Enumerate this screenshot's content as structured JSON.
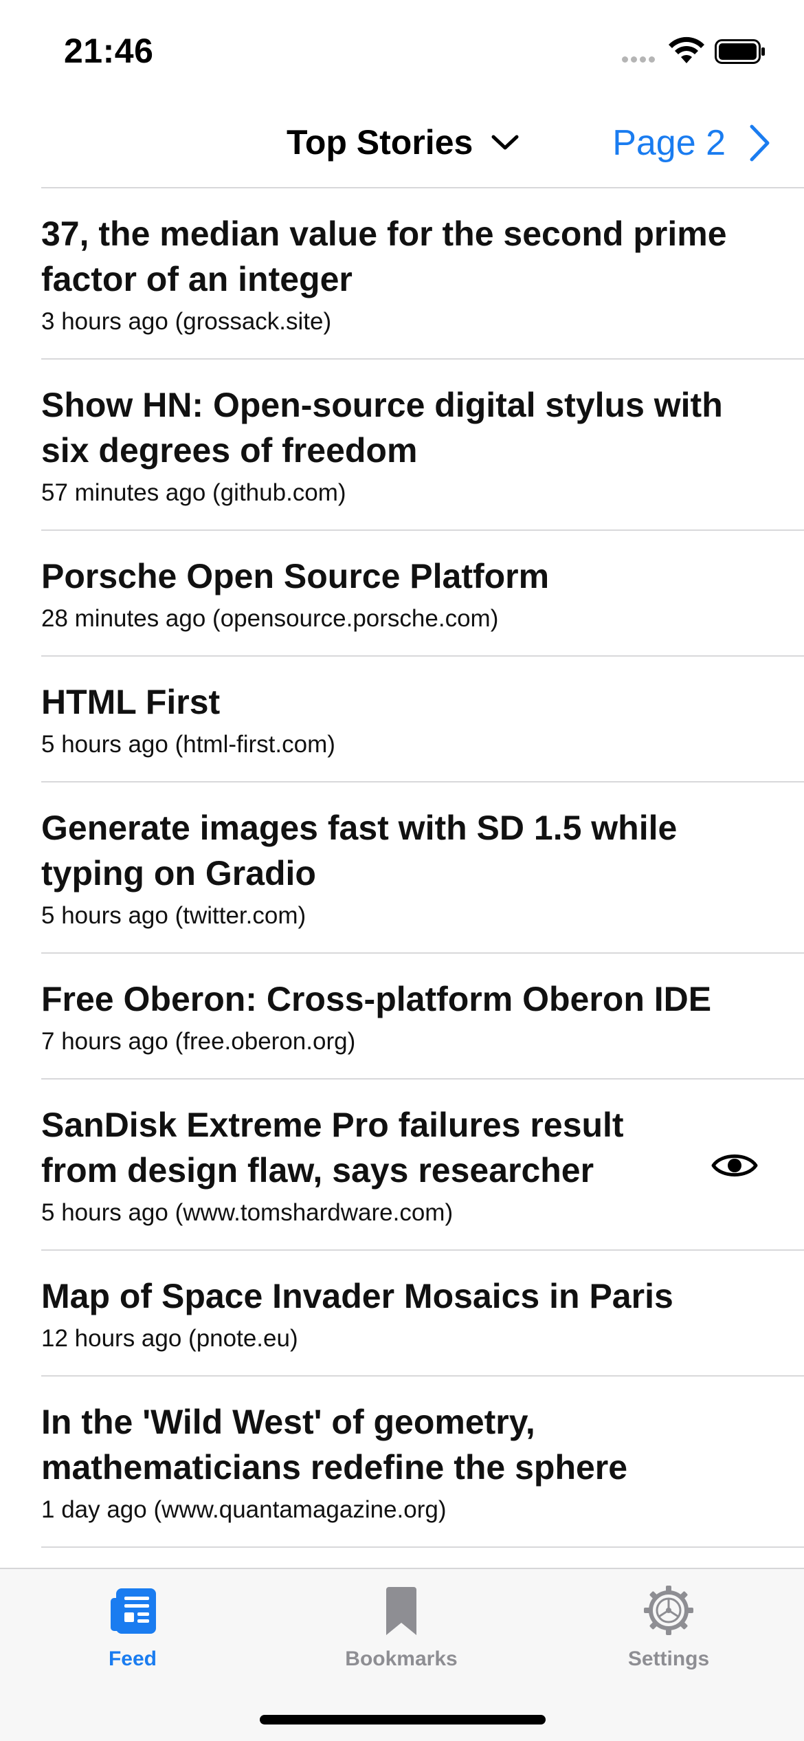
{
  "status_bar": {
    "time": "21:46"
  },
  "header": {
    "title": "Top Stories",
    "page_label": "Page 2"
  },
  "stories": [
    {
      "title": "37, the median value for the second prime factor of an integer",
      "meta": "3 hours ago (grossack.site)"
    },
    {
      "title": "Show HN: Open-source digital stylus with six degrees of freedom",
      "meta": "57 minutes ago (github.com)"
    },
    {
      "title": "Porsche Open Source Platform",
      "meta": "28 minutes ago (opensource.porsche.com)"
    },
    {
      "title": "HTML First",
      "meta": "5 hours ago (html-first.com)"
    },
    {
      "title": "Generate images fast with SD 1.5 while typing on Gradio",
      "meta": "5 hours ago (twitter.com)"
    },
    {
      "title": "Free Oberon: Cross-platform Oberon IDE",
      "meta": "7 hours ago (free.oberon.org)"
    },
    {
      "title": "SanDisk Extreme Pro failures result from design flaw, says researcher",
      "meta": "5 hours ago (www.tomshardware.com)",
      "icon": "eye-icon"
    },
    {
      "title": "Map of Space Invader Mosaics in Paris",
      "meta": "12 hours ago (pnote.eu)"
    },
    {
      "title": "In the 'Wild West' of geometry, mathematicians redefine the sphere",
      "meta": "1 day ago (www.quantamagazine.org)"
    }
  ],
  "tab_bar": {
    "active_tab": "Feed",
    "tabs": [
      {
        "label": "Feed",
        "icon": "newspaper-icon"
      },
      {
        "label": "Bookmarks",
        "icon": "bookmark-icon"
      },
      {
        "label": "Settings",
        "icon": "gear-icon"
      }
    ]
  },
  "colors": {
    "accent": "#1a7cf0",
    "inactive": "#8e8e93",
    "separator": "#d8d8da"
  }
}
